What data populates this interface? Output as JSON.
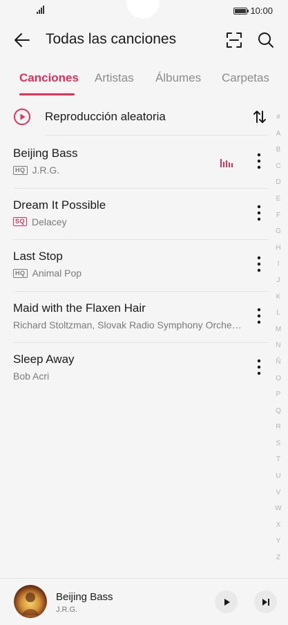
{
  "status_bar": {
    "time": "10:00"
  },
  "header": {
    "title": "Todas las canciones",
    "back_icon": "back-arrow-icon",
    "scan_icon": "scan-icon",
    "search_icon": "search-icon"
  },
  "tabs": [
    {
      "label": "Canciones",
      "active": true
    },
    {
      "label": "Artistas",
      "active": false
    },
    {
      "label": "Álbumes",
      "active": false
    },
    {
      "label": "Carpetas",
      "active": false
    }
  ],
  "shuffle": {
    "label": "Reproducción aleatoria"
  },
  "songs": [
    {
      "title": "Beijing Bass",
      "badge": "HQ",
      "artist": "J.R.G.",
      "playing": true
    },
    {
      "title": "Dream It Possible",
      "badge": "SQ",
      "artist": "Delacey",
      "playing": false
    },
    {
      "title": "Last Stop",
      "badge": "HQ",
      "artist": "Animal Pop",
      "playing": false
    },
    {
      "title": "Maid with the Flaxen Hair",
      "badge": "",
      "artist": "Richard Stoltzman, Slovak Radio Symphony Orche…",
      "playing": false
    },
    {
      "title": "Sleep Away",
      "badge": "",
      "artist": "Bob Acri",
      "playing": false
    }
  ],
  "alphabet": [
    "#",
    "A",
    "B",
    "C",
    "D",
    "E",
    "F",
    "G",
    "H",
    "I",
    "J",
    "K",
    "L",
    "M",
    "N",
    "Ñ",
    "O",
    "P",
    "Q",
    "R",
    "S",
    "T",
    "U",
    "V",
    "W",
    "X",
    "Y",
    "Z"
  ],
  "now_playing": {
    "title": "Beijing Bass",
    "artist": "J.R.G."
  },
  "colors": {
    "accent": "#e5305a",
    "background": "#f5f5f5"
  }
}
